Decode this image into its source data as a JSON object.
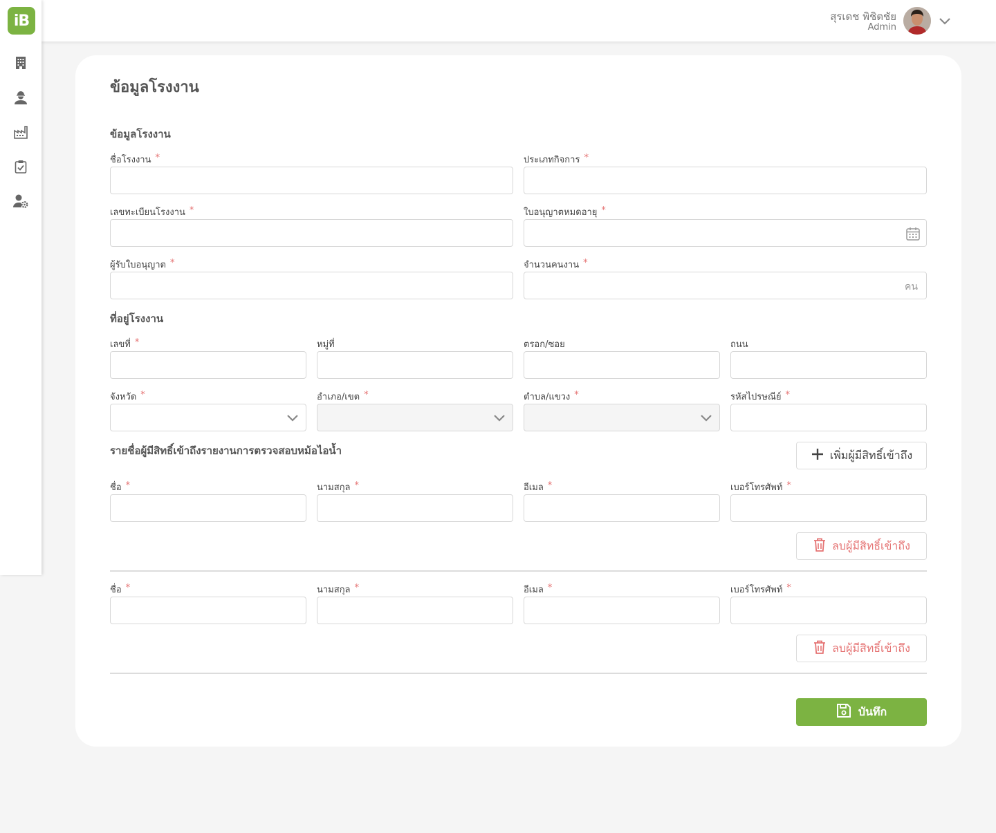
{
  "app": {
    "logo_text": "iB"
  },
  "sidebar": {
    "items": [
      {
        "name": "building-icon"
      },
      {
        "name": "worker-icon"
      },
      {
        "name": "factory-icon"
      },
      {
        "name": "clipboard-check-icon"
      },
      {
        "name": "user-settings-icon"
      }
    ]
  },
  "header": {
    "user_name": "สุรเดช พิชิตชัย",
    "user_role": "Admin"
  },
  "page": {
    "title": "ข้อมูลโรงงาน",
    "save_label": "บันทึก"
  },
  "factory_info": {
    "title": "ข้อมูลโรงงาน",
    "name_label": "ชื่อโรงงาน",
    "business_type_label": "ประเภทกิจการ",
    "registration_no_label": "เลขทะเบียนโรงงาน",
    "license_expiry_label": "ใบอนุญาตหมดอายุ",
    "licensee_label": "ผู้รับใบอนุญาต",
    "employee_count_label": "จำนวนคนงาน",
    "employee_unit": "คน"
  },
  "address": {
    "title": "ที่อยู่โรงงาน",
    "house_no_label": "เลขที่",
    "village_no_label": "หมู่ที่",
    "alley_label": "ตรอก/ซอย",
    "road_label": "ถนน",
    "province_label": "จังหวัด",
    "district_label": "อำเภอ/เขต",
    "subdistrict_label": "ตำบล/แขวง",
    "postcode_label": "รหัสไปรษณีย์"
  },
  "access": {
    "title": "รายชื่อผู้มีสิทธิ์เข้าถึงรายงานการตรวจสอบหม้อไอน้ำ",
    "add_label": "เพิ่มผู้มีสิทธิ์เข้าถึง",
    "delete_label": "ลบผู้มีสิทธิ์เข้าถึง",
    "first_name_label": "ชื่อ",
    "last_name_label": "นามสกุล",
    "email_label": "อีเมล",
    "phone_label": "เบอร์โทรศัพท์"
  },
  "required_mark": "*",
  "colors": {
    "brand": "#7cb342",
    "danger": "#e57373"
  }
}
